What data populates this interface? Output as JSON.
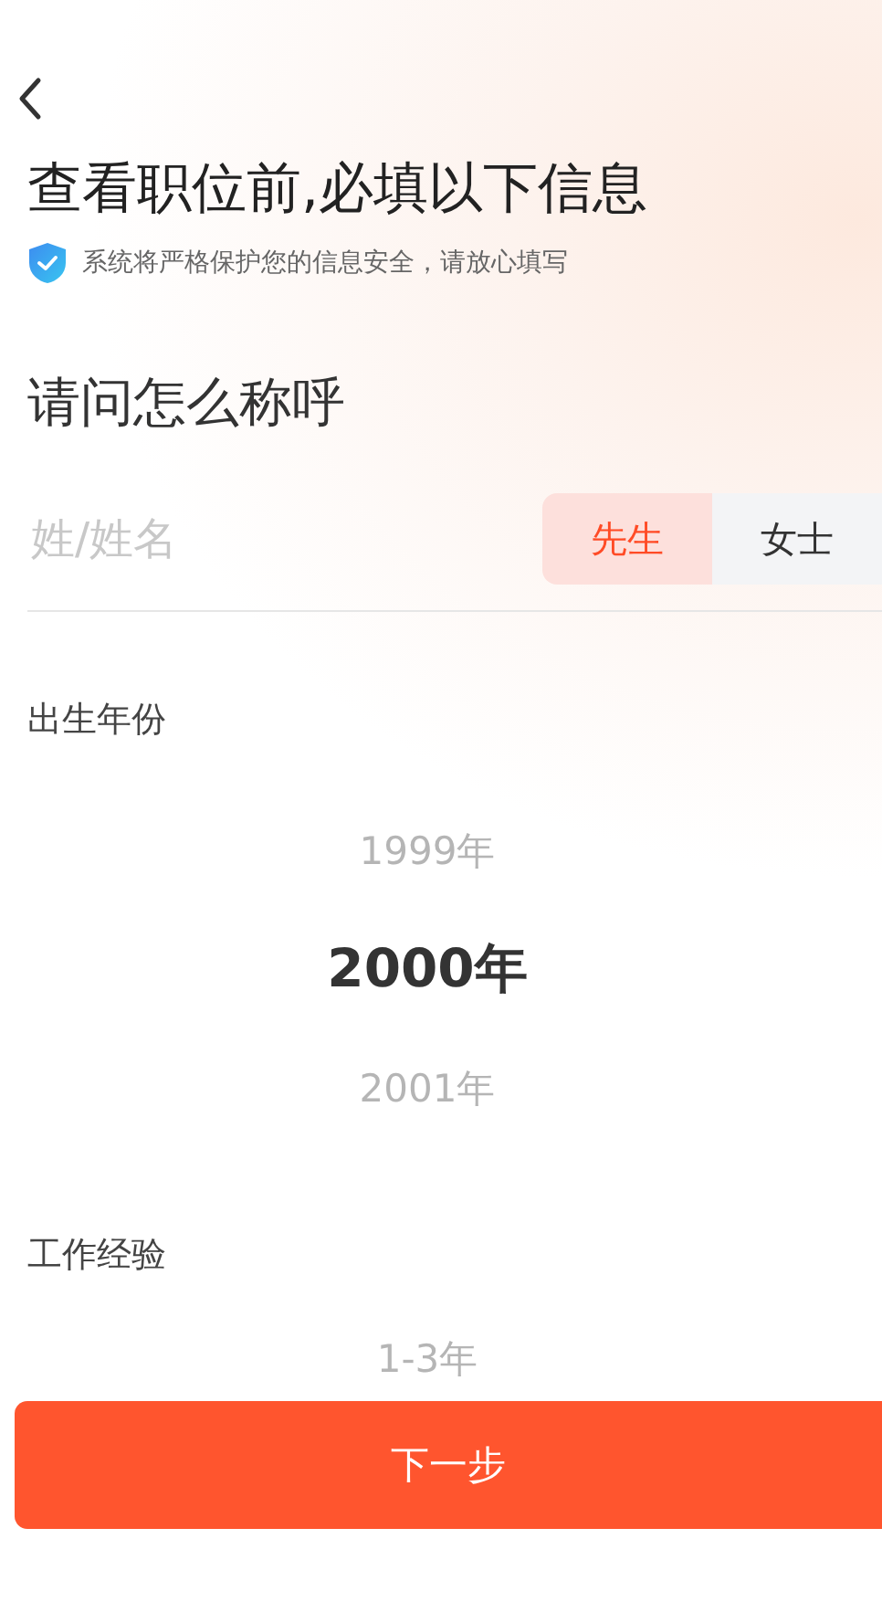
{
  "header": {
    "title": "查看职位前,必填以下信息",
    "notice": "系统将严格保护您的信息安全，请放心填写"
  },
  "name_section": {
    "question": "请问怎么称呼",
    "name_field": {
      "placeholder": "姓/姓名"
    },
    "salutations": [
      {
        "label": "先生",
        "selected": true
      },
      {
        "label": "女士",
        "selected": false
      }
    ]
  },
  "birth_year": {
    "label": "出生年份",
    "options": [
      {
        "label": "1999年",
        "selected": false
      },
      {
        "label": "2000年",
        "selected": true
      },
      {
        "label": "2001年",
        "selected": false
      }
    ]
  },
  "work_experience": {
    "label": "工作经验",
    "options": [
      {
        "label": "1-3年",
        "selected": false
      }
    ]
  },
  "next_button": "下一步"
}
